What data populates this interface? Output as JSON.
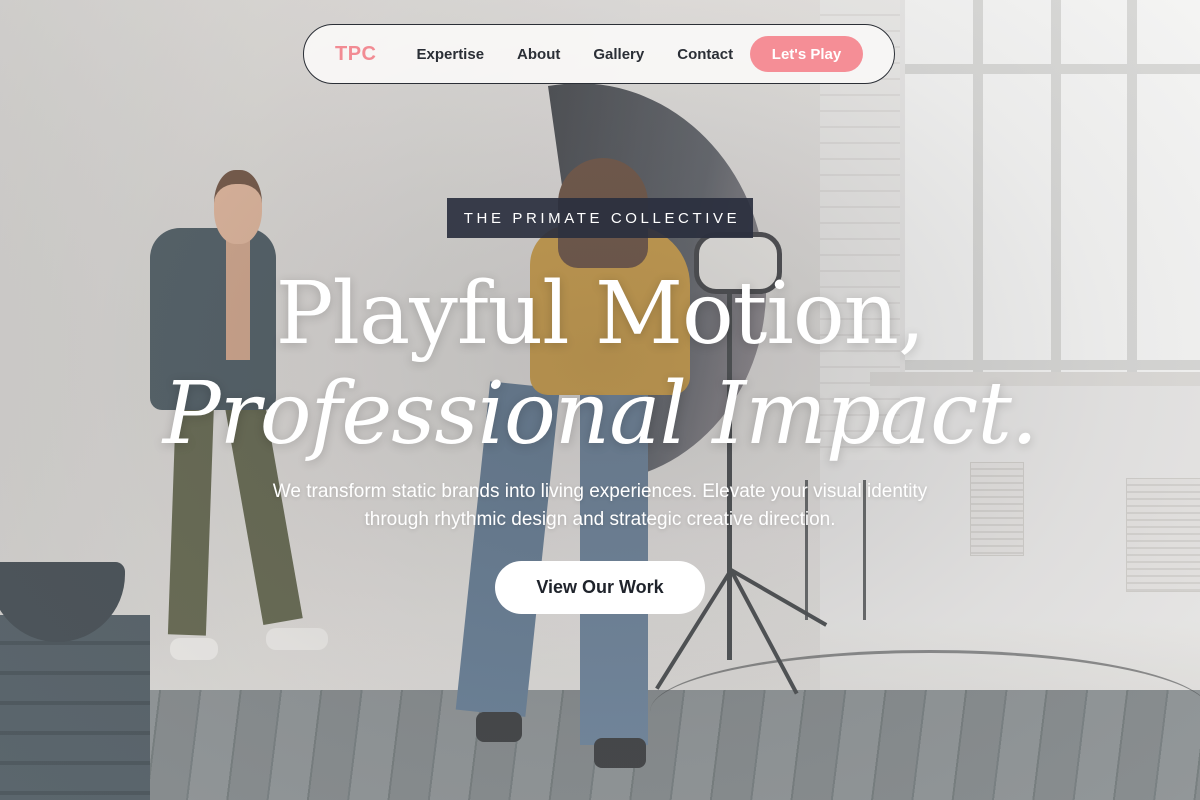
{
  "nav": {
    "logo": "TPC",
    "links": [
      {
        "label": "Expertise"
      },
      {
        "label": "About"
      },
      {
        "label": "Gallery"
      },
      {
        "label": "Contact"
      }
    ],
    "cta_label": "Let's Play"
  },
  "hero": {
    "badge": "THE PRIMATE COLLECTIVE",
    "headline_line1": "Playful Motion,",
    "headline_line2": "Professional Impact.",
    "subtitle": "We transform static brands into living experiences. Elevate your visual identity through rhythmic design and strategic creative direction.",
    "cta_label": "View Our Work"
  },
  "colors": {
    "accent": "#f58e96",
    "logo": "#f28b93",
    "badge_bg": "#2a2f3e",
    "text_dark": "#2b2f36"
  }
}
